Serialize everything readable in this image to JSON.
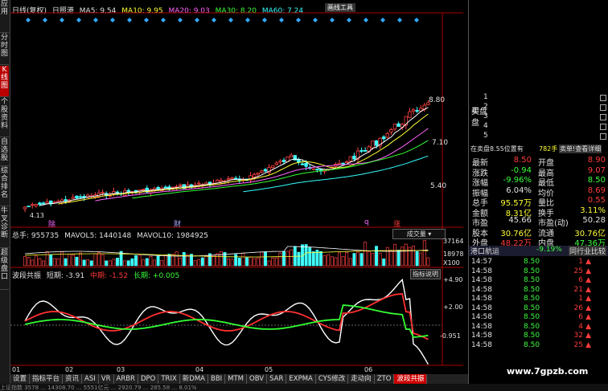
{
  "left_tabs": [
    "应用",
    "分时图",
    "K线图",
    "个股资料",
    "自选股",
    "综合排名",
    "牛叉诊断",
    "超级盘口"
  ],
  "top": {
    "period": "日线(复权)",
    "name": "日照港",
    "ma5": "MA5: 9.54",
    "ma10": "MA10: 9.95",
    "ma20": "MA20: 9.03",
    "ma30": "MA30: 8.20",
    "ma60": "MA60: 7.24",
    "tool_label": "画线工具"
  },
  "price_axis": [
    "8.80",
    "7.10",
    "5.40"
  ],
  "low_label": "4.13",
  "markers": [
    "除",
    "财",
    "q",
    "涨"
  ],
  "volume": {
    "total": "总手: 955735",
    "mavol5": "MAVOL5: 1440148",
    "mavol10": "MAVOL10: 1984925",
    "selector": "成交量",
    "axis": [
      "37164",
      "18978",
      "X100"
    ]
  },
  "indicator": {
    "name": "波段共振",
    "short": "短期: -3.91",
    "mid": "中期: -1.52",
    "long": "长期: +0.005",
    "help": "指标说明",
    "axis": [
      "+4.90",
      "+2.00",
      "-0.951"
    ]
  },
  "date_ticks": [
    "01",
    "02",
    "03",
    "04",
    "05",
    "06"
  ],
  "bottom_tabs": [
    "设置",
    "指标平台",
    "资讯",
    "ASI",
    "VR",
    "ARBR",
    "DPO",
    "TRIX",
    "新DMA",
    "BBI",
    "MTM",
    "OBV",
    "SAR",
    "EXPMA",
    "CYS修改",
    "走动向",
    "ZTO",
    "波段共振"
  ],
  "bottom_tab_arrow": "细",
  "order_book": {
    "sell": [
      {
        "label": "卖",
        "n": "1"
      },
      {
        "label": "",
        "n": "2"
      },
      {
        "label": "",
        "n": "3"
      },
      {
        "label": "",
        "n": "4"
      },
      {
        "label": "",
        "n": "5"
      }
    ],
    "buy_label": "买盘",
    "buy_n": [
      "1",
      "2",
      "3",
      "4",
      "5"
    ],
    "buy_label2": "盘"
  },
  "info_line": {
    "text": "在卖盘8.55位置有",
    "vol": "782手",
    "link": "卖单!查看详细"
  },
  "quotes": [
    {
      "l": "最新",
      "v": "8.50",
      "l2": "开盘",
      "v2": "8.90",
      "c1": "red",
      "c2": "red"
    },
    {
      "l": "涨跌",
      "v": "-0.94",
      "l2": "最高",
      "v2": "9.07",
      "c1": "green",
      "c2": "red"
    },
    {
      "l": "涨幅",
      "v": "-9.96%",
      "l2": "最低",
      "v2": "8.50",
      "c1": "green",
      "c2": "green"
    },
    {
      "l": "振幅",
      "v": "6.04%",
      "l2": "均价",
      "v2": "8.69",
      "c1": "white",
      "c2": "red"
    },
    {
      "l": "总手",
      "v": "95.57万",
      "l2": "量比",
      "v2": "0.55",
      "c1": "yellow",
      "c2": "red"
    },
    {
      "l": "金额",
      "v": "8.31亿",
      "l2": "换手",
      "v2": "3.11%",
      "c1": "yellow",
      "c2": "yellow"
    },
    {
      "l": "市盈",
      "v": "45.66",
      "l2": "市盈(动)",
      "v2": "50.28",
      "c1": "white",
      "c2": "white"
    },
    {
      "l": "股本",
      "v": "30.76亿",
      "l2": "流通",
      "v2": "30.76亿",
      "c1": "yellow",
      "c2": "yellow"
    },
    {
      "l": "外盘",
      "v": "48.22万",
      "l2": "内盘",
      "v2": "47.36万",
      "c1": "red",
      "c2": "green"
    }
  ],
  "sector": {
    "name": "港口航运",
    "pct": "-9.19%",
    "compare": "同行业比较"
  },
  "ticks": [
    {
      "t": "14:57",
      "p": "8.50",
      "v": "1"
    },
    {
      "t": "14:58",
      "p": "8.50",
      "v": "25"
    },
    {
      "t": "14:58",
      "p": "8.50",
      "v": "6"
    },
    {
      "t": "14:58",
      "p": "8.50",
      "v": "21"
    },
    {
      "t": "14:58",
      "p": "8.50",
      "v": "1"
    },
    {
      "t": "14:58",
      "p": "8.50",
      "v": "26"
    },
    {
      "t": "14:58",
      "p": "8.50",
      "v": "6"
    },
    {
      "t": "14:58",
      "p": "8.50",
      "v": "4"
    },
    {
      "t": "14:58",
      "p": "8.50",
      "v": "32"
    },
    {
      "t": "14:58",
      "p": "8.50",
      "v": "25"
    }
  ],
  "watermark": "www.7gpzb.com",
  "status": "上证指数  3578 ...  14308.70 ...  5551亿元  ...  2920.79 ...  285.58 ...  8.01%"
}
